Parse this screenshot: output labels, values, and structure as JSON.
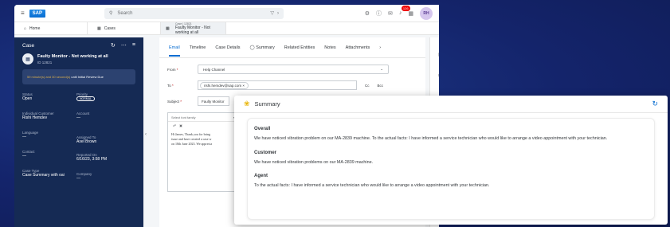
{
  "shell": {
    "logo": "SAP",
    "search_placeholder": "Search",
    "notif_count": "126",
    "avatar": "RH"
  },
  "tabs": {
    "home": "Home",
    "cases": "Cases",
    "case_small": "Case | 12821",
    "case_title": "Faulty Monitor - Not working at all"
  },
  "panel": {
    "header": "Case",
    "case_name": "Faulty Monitor - Not working at all",
    "case_id": "ID 12821",
    "timer_highlight": "59 minute(s) and 30 second(s)",
    "timer_rest": "until Initial Review Due",
    "fields": [
      {
        "label": "Status",
        "value": "Open"
      },
      {
        "label": "Priority",
        "value": "NORMAL"
      },
      {
        "label": "Individual Customer",
        "value": "Rishi Hemdev"
      },
      {
        "label": "Account",
        "value": "—"
      },
      {
        "label": "Language",
        "value": "—"
      },
      {
        "label": "Assigned To",
        "value": "Axel Brown"
      },
      {
        "label": "Contact",
        "value": "—"
      },
      {
        "label": "Reported On",
        "value": "6/16/23, 3:58 PM"
      },
      {
        "label": "Case Type",
        "value": "Case Summary with oai"
      },
      {
        "label": "Company",
        "value": "—"
      }
    ]
  },
  "main": {
    "tabs": [
      "Email",
      "Timeline",
      "Case Details",
      "Summary",
      "Related Entities",
      "Notes",
      "Attachments"
    ],
    "from_label": "From",
    "from_value": "Help Channel",
    "to_label": "To",
    "to_chip": "rishi.hemdev@sap.com",
    "cc": "Cc",
    "bcc": "Bcc",
    "subject_label": "Subject",
    "subject_value": "Faulty Monitor",
    "font_select": "Select font family",
    "body_lines": [
      "Hi James, Thank you for bring",
      "issue and have created a case w",
      "on 18th June 2023. We apprecia"
    ]
  },
  "summary": {
    "title": "Summary",
    "sections": [
      {
        "heading": "Overall",
        "text": "We have noticed vibration problem on our MA-2839 machine. To the actual facts: I have informed a service technician who would like to arrange a video appointment with your technician."
      },
      {
        "heading": "Customer",
        "text": "We have noticed vibration problems on our MA-2839 machine."
      },
      {
        "heading": "Agent",
        "text": "To the actual facts: I have informed a service technician who would like to arrange a video appointment with your technician."
      }
    ]
  }
}
